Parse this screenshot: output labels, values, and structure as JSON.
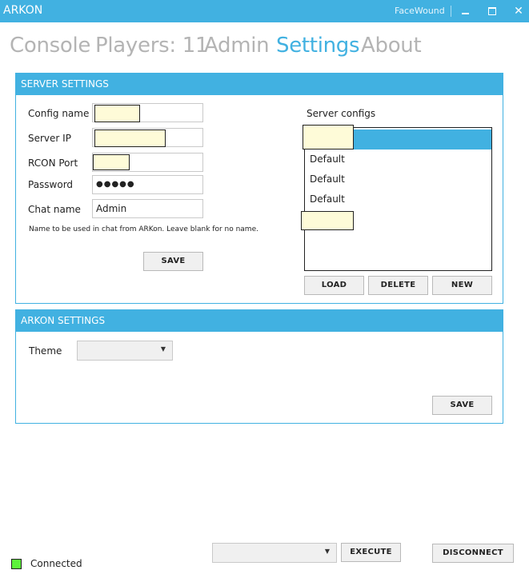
{
  "titlebar": {
    "app_title": "ARKON",
    "user": "FaceWound",
    "minimize_glyph": "",
    "maximize_glyph": "",
    "close_glyph": "✕"
  },
  "nav": {
    "tabs": [
      {
        "label": "Console"
      },
      {
        "label": "Players: 11"
      },
      {
        "label": "Admin"
      },
      {
        "label": "Settings",
        "active": true
      },
      {
        "label": "About"
      }
    ]
  },
  "server_settings": {
    "header": "SERVER SETTINGS",
    "config_name_label": "Config name",
    "server_ip_label": "Server IP",
    "rcon_port_label": "RCON Port",
    "password_label": "Password",
    "password_value": "●●●●●",
    "chat_name_label": "Chat name",
    "chat_name_value": "Admin",
    "chat_hint": "Name to be used in chat from ARKon. Leave blank for no name.",
    "save_label": "SAVE",
    "server_configs_label": "Server configs",
    "configs": [
      "",
      "Default",
      "Default",
      "Default",
      ""
    ],
    "load_label": "LOAD",
    "delete_label": "DELETE",
    "new_label": "NEW"
  },
  "arkon_settings": {
    "header": "ARKON SETTINGS",
    "theme_label": "Theme",
    "theme_value": "",
    "save_label": "SAVE"
  },
  "footer": {
    "status": "Connected",
    "status_color": "#5cf23a",
    "command_value": "",
    "execute_label": "EXECUTE",
    "disconnect_label": "DISCONNECT"
  },
  "colors": {
    "accent": "#41b1e1",
    "inactive_tab": "#b4b4b4",
    "redaction": "#fefbd8"
  }
}
